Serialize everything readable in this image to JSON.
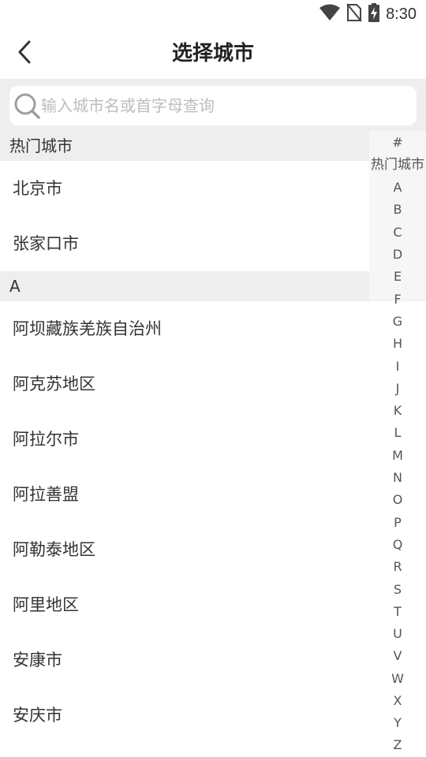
{
  "status_bar": {
    "time": "8:30"
  },
  "nav": {
    "title": "选择城市"
  },
  "search": {
    "placeholder": "输入城市名或首字母查询"
  },
  "sections": {
    "hot": {
      "header": "热门城市",
      "cities": [
        "北京市",
        "张家口市"
      ]
    },
    "a": {
      "header": "A",
      "cities": [
        "阿坝藏族羌族自治州",
        "阿克苏地区",
        "阿拉尔市",
        "阿拉善盟",
        "阿勒泰地区",
        "阿里地区",
        "安康市",
        "安庆市"
      ]
    }
  },
  "index_bar": [
    "#",
    "热门城市",
    "A",
    "B",
    "C",
    "D",
    "E",
    "F",
    "G",
    "H",
    "I",
    "J",
    "K",
    "L",
    "M",
    "N",
    "O",
    "P",
    "Q",
    "R",
    "S",
    "T",
    "U",
    "V",
    "W",
    "X",
    "Y",
    "Z"
  ]
}
